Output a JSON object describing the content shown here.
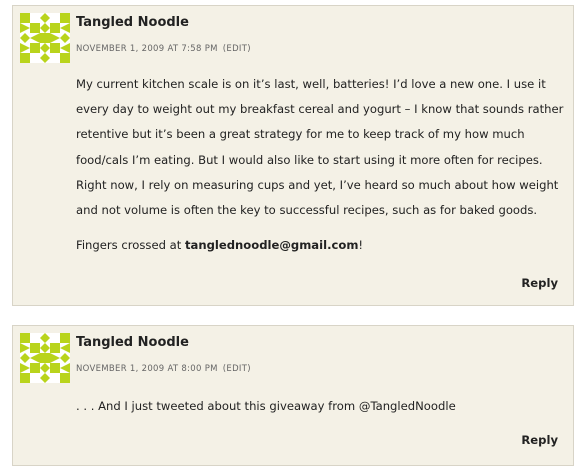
{
  "comments": [
    {
      "author": "Tangled Noodle",
      "timestamp": "NOVEMBER 1, 2009 AT 7:58 PM",
      "edit_label": "(EDIT)",
      "body_text": "My current kitchen scale is on it’s last, well, batteries! I’d love a new one. I use it every day to weight out my breakfast cereal and yogurt – I know that sounds rather retentive but it’s been a great strategy for me to keep track of my how much food/cals I’m eating. But I would also like to start using it more often for recipes. Right now, I rely on measuring cups and yet, I’ve heard so much about how weight and not volume is often the key to successful recipes, such as for baked goods.",
      "closing_prefix": "Fingers crossed at ",
      "closing_email": "tanglednoodle@gmail.com",
      "closing_suffix": "!",
      "reply_label": "Reply",
      "avatar_color": "#b9d41c"
    },
    {
      "author": "Tangled Noodle",
      "timestamp": "NOVEMBER 1, 2009 AT 8:00 PM",
      "edit_label": "(EDIT)",
      "body_text": ". . . And I just tweeted about this giveaway from @TangledNoodle",
      "reply_label": "Reply",
      "avatar_color": "#b9d41c"
    }
  ]
}
